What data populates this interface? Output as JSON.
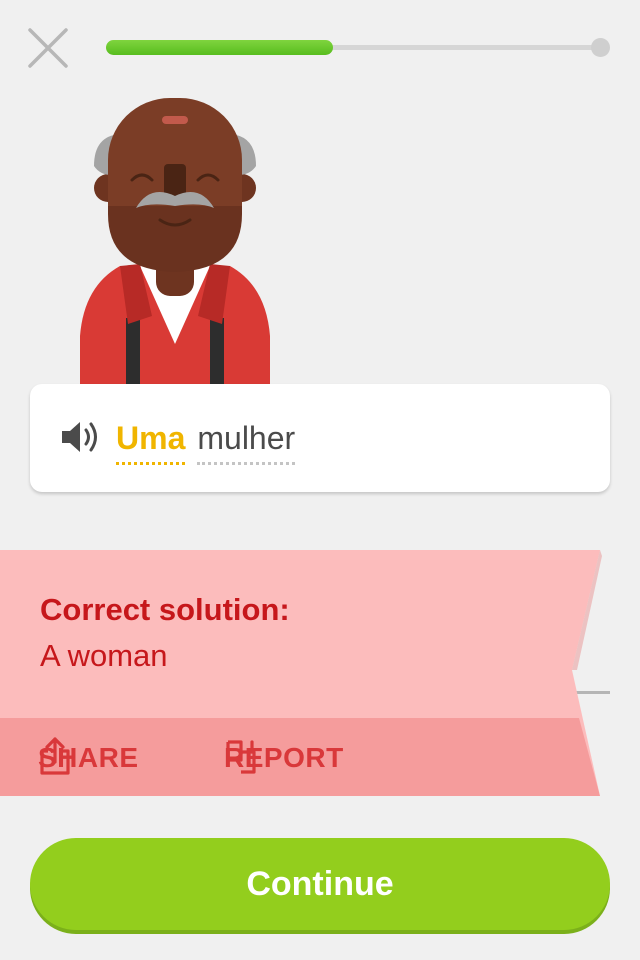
{
  "header": {
    "close_icon": "close-icon",
    "progress": 0.46
  },
  "prompt": {
    "speaker_icon": "speaker-icon",
    "words": [
      "Uma",
      "mulher"
    ],
    "highlighted_word": "Uma"
  },
  "feedback": {
    "title": "Correct solution:",
    "answer": "A woman",
    "share_label": "SHARE",
    "share_icon": "share-icon",
    "report_label": "REPORT",
    "report_icon": "flag-icon",
    "colors": {
      "banner": "#fcbcbc",
      "strip": "#f59c9c",
      "text": "#c6171b"
    }
  },
  "footer": {
    "continue_label": "Continue",
    "color": "#93ce1d"
  }
}
